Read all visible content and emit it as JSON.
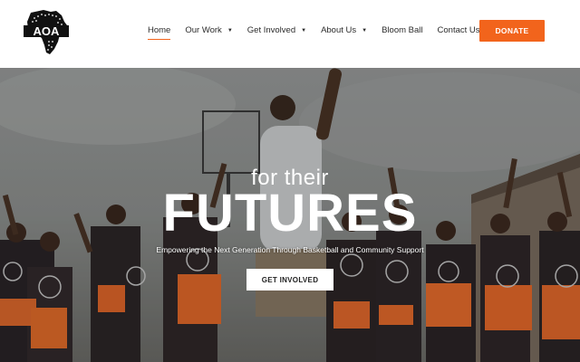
{
  "brand": {
    "logo_text": "AOA"
  },
  "nav": {
    "items": [
      {
        "label": "Home",
        "dropdown": false,
        "active": true
      },
      {
        "label": "Our Work",
        "dropdown": true
      },
      {
        "label": "Get Involved",
        "dropdown": true
      },
      {
        "label": "About Us",
        "dropdown": true
      },
      {
        "label": "Bloom Ball",
        "dropdown": false
      },
      {
        "label": "Contact Us",
        "dropdown": false
      }
    ],
    "donate_label": "DONATE"
  },
  "hero": {
    "line1": "for their",
    "line2": "FUTURES",
    "subtitle": "Empowering the Next Generation Through Basketball and Community Support",
    "cta_label": "GET INVOLVED"
  },
  "colors": {
    "accent": "#f2641c",
    "text": "#2b2b2b"
  }
}
